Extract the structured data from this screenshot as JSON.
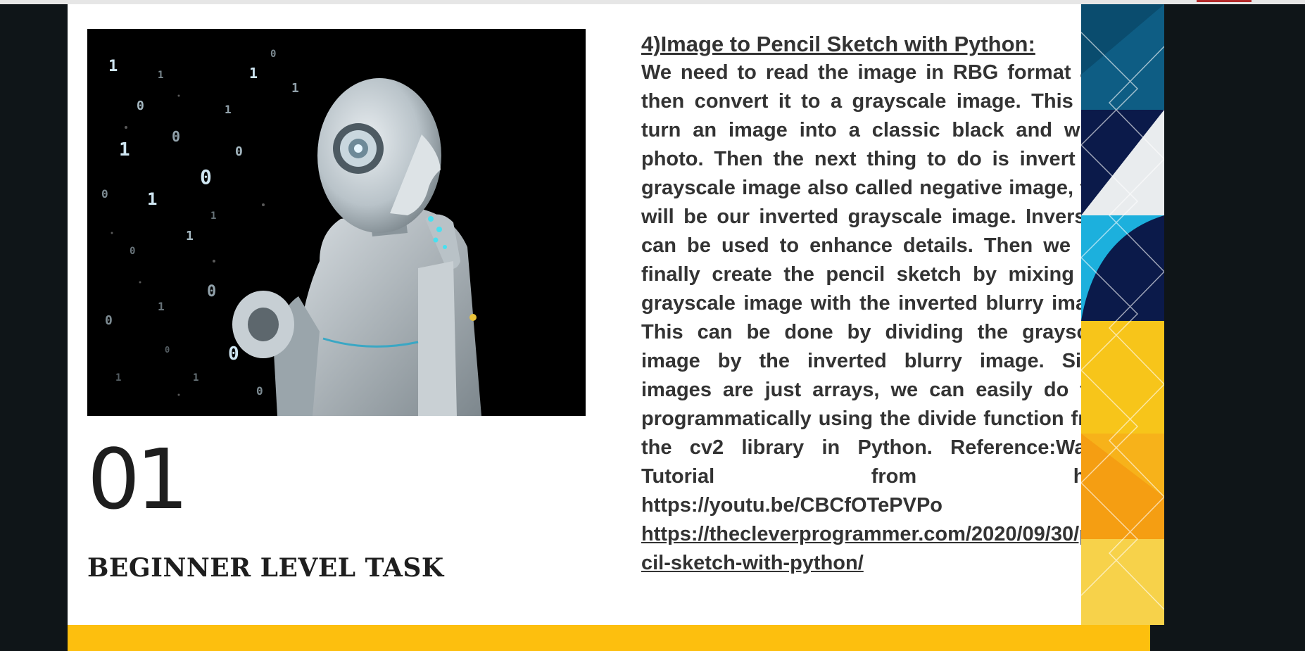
{
  "slide": {
    "number": "01",
    "level_label": "BEGINNER LEVEL TASK",
    "image_icon": "robot-thinking-image",
    "heading": "4)Image to Pencil Sketch with Python:",
    "body": "We need to read the image in RBG format and then convert it to a grayscale image. This will turn an image into a classic black and white photo. Then the next thing to do is invert the grayscale image also called negative image, this will be our inverted grayscale image. Inversion can be used to enhance details. Then we can finally create the pencil sketch by mixing the grayscale image with the inverted blurry image. This can be done by dividing the grayscale image by the inverted blurry image. Since images are just arrays, we can easily do this programmatically using the divide function from the cv2 library in Python. Reference:Watch Tutorial from here",
    "url_youtube": "https://youtu.be/CBCfOTePVPo",
    "url_article": "https://thecleverprogrammer.com/2020/09/30/pencil-sketch-with-python/"
  },
  "colors": {
    "background": "#0f1518",
    "slide": "#ffffff",
    "text": "#333333",
    "footer": "#fdbf0e"
  }
}
